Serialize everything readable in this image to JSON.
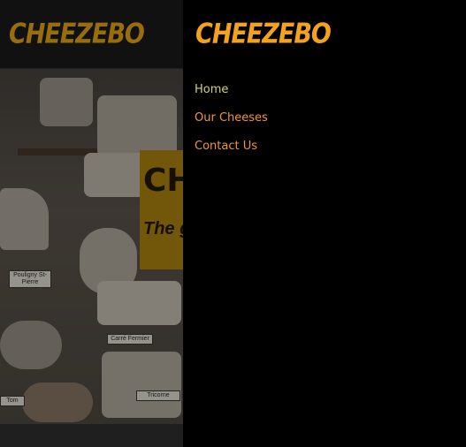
{
  "brand": {
    "logo_text": "CHEEZEBO",
    "accent": "#f2a21e"
  },
  "page": {
    "hero_banner": {
      "line1": "CH",
      "line2": "The g"
    },
    "cheese_tags": [
      "Pouligny St-Pierre",
      "Carré Fermier",
      "Tricorne",
      "Tom"
    ]
  },
  "nav": {
    "items": [
      {
        "label": "Home",
        "active": true,
        "color": "#d6d26a"
      },
      {
        "label": "Our Cheeses",
        "active": false,
        "color": "#f0953a"
      },
      {
        "label": "Contact Us",
        "active": false,
        "color": "#f0953a"
      }
    ]
  }
}
